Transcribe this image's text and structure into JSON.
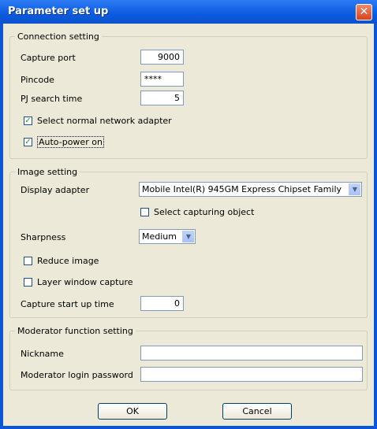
{
  "window": {
    "title": "Parameter set up"
  },
  "connection": {
    "legend": "Connection setting",
    "capture_port_label": "Capture port",
    "capture_port_value": "9000",
    "pincode_label": "Pincode",
    "pincode_value": "****",
    "pj_search_label": "PJ search time",
    "pj_search_value": "5",
    "normal_adapter_label": "Select normal network adapter",
    "normal_adapter_checked": true,
    "auto_power_label": "Auto-power on",
    "auto_power_checked": true
  },
  "image": {
    "legend": "Image setting",
    "display_adapter_label": "Display adapter",
    "display_adapter_value": "Mobile Intel(R) 945GM Express Chipset Family",
    "select_capturing_label": "Select capturing object",
    "select_capturing_checked": false,
    "sharpness_label": "Sharpness",
    "sharpness_value": "Medium",
    "reduce_image_label": "Reduce image",
    "reduce_image_checked": false,
    "layer_window_label": "Layer window capture",
    "layer_window_checked": false,
    "startup_time_label": "Capture start up time",
    "startup_time_value": "0"
  },
  "moderator": {
    "legend": "Moderator function setting",
    "nickname_label": "Nickname",
    "nickname_value": "",
    "password_label": "Moderator login password",
    "password_value": ""
  },
  "buttons": {
    "ok": "OK",
    "cancel": "Cancel"
  },
  "icons": {
    "close": "close-icon",
    "check": "checkmark-icon",
    "dropdown": "chevron-down-icon"
  },
  "colors": {
    "titlebar": "#0b5be0",
    "close_button": "#d8431c",
    "dialog_bg": "#ece9d8"
  }
}
